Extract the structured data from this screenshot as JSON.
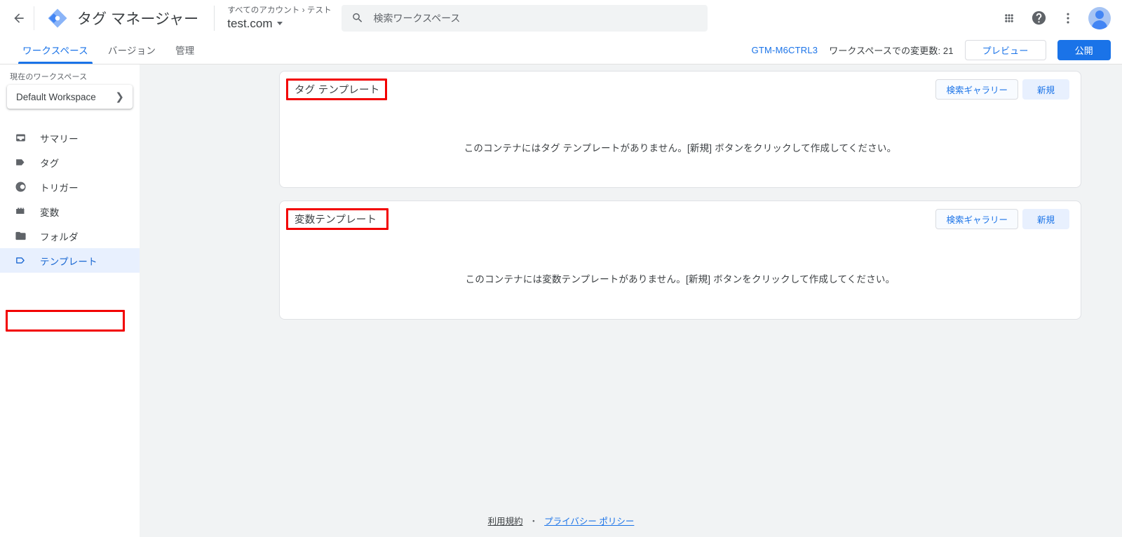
{
  "header": {
    "back_icon": "arrow-back-icon",
    "logo_icon": "tag-manager-logo",
    "title": "タグ マネージャー",
    "account_breadcrumb": "すべてのアカウント › テスト",
    "container_name": "test.com",
    "search": {
      "icon": "search-icon",
      "placeholder": "検索ワークスペース",
      "value": ""
    },
    "icons": {
      "apps": "apps-grid-icon",
      "help": "help-circle-icon",
      "more": "more-vert-icon",
      "avatar": "user-avatar"
    }
  },
  "tabbar": {
    "tabs": [
      {
        "label": "ワークスペース",
        "active": true
      },
      {
        "label": "バージョン",
        "active": false
      },
      {
        "label": "管理",
        "active": false
      }
    ],
    "container_id": "GTM-M6CTRL3",
    "changes_label": "ワークスペースでの変更数: 21",
    "preview_label": "プレビュー",
    "publish_label": "公開"
  },
  "sidebar": {
    "workspace_label": "現在のワークスペース",
    "workspace_name": "Default Workspace",
    "workspace_chevron": "chevron-right-icon",
    "items": [
      {
        "label": "サマリー",
        "icon": "summary-icon",
        "active": false
      },
      {
        "label": "タグ",
        "icon": "tag-icon",
        "active": false
      },
      {
        "label": "トリガー",
        "icon": "trigger-icon",
        "active": false
      },
      {
        "label": "変数",
        "icon": "variable-icon",
        "active": false
      },
      {
        "label": "フォルダ",
        "icon": "folder-icon",
        "active": false
      },
      {
        "label": "テンプレート",
        "icon": "template-icon",
        "active": true
      }
    ]
  },
  "main": {
    "cards": [
      {
        "title": "タグ テンプレート",
        "gallery_label": "検索ギャラリー",
        "new_label": "新規",
        "empty_message": "このコンテナにはタグ テンプレートがありません。[新規] ボタンをクリックして作成してください。"
      },
      {
        "title": "変数テンプレート",
        "gallery_label": "検索ギャラリー",
        "new_label": "新規",
        "empty_message": "このコンテナには変数テンプレートがありません。[新規] ボタンをクリックして作成してください。"
      }
    ]
  },
  "footer": {
    "terms": "利用規約",
    "separator": "・",
    "privacy": "プライバシー ポリシー"
  },
  "colors": {
    "accent": "#1a73e8",
    "accent_light": "#e8f0fe",
    "page_bg": "#f1f3f4",
    "annotation": "#f20000",
    "text_primary": "#3c4043",
    "text_secondary": "#5f6368"
  }
}
